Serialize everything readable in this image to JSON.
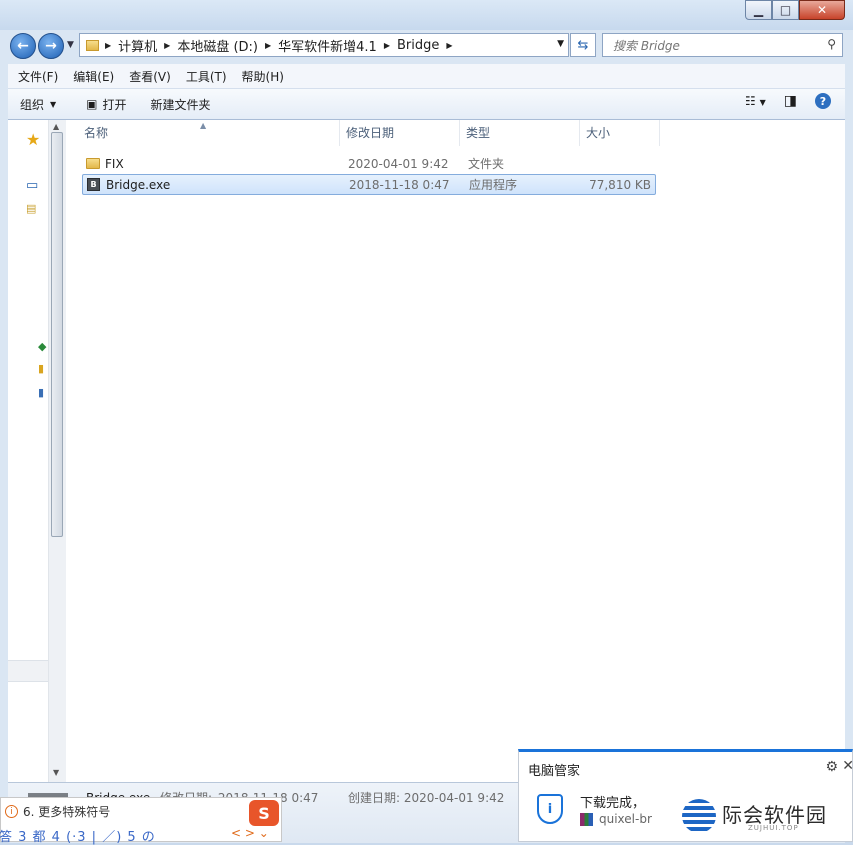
{
  "window": {
    "minimize": "▁",
    "maximize": "□",
    "close": "✕"
  },
  "address": {
    "crumbs": [
      "计算机",
      "本地磁盘 (D:)",
      "华军软件新增4.1",
      "Bridge"
    ],
    "search_placeholder": "搜索 Bridge"
  },
  "menu": [
    "文件(F)",
    "编辑(E)",
    "查看(V)",
    "工具(T)",
    "帮助(H)"
  ],
  "toolbar": {
    "organize": "组织",
    "open": "打开",
    "new_folder": "新建文件夹"
  },
  "columns": [
    "名称",
    "修改日期",
    "类型",
    "大小"
  ],
  "files": [
    {
      "name": "FIX",
      "date": "2020-04-01 9:42",
      "type": "文件夹",
      "size": ""
    },
    {
      "name": "Bridge.exe",
      "date": "2018-11-18 0:47",
      "type": "应用程序",
      "size": "77,810 KB"
    }
  ],
  "details": {
    "name": "Bridge.exe",
    "modified_label": "修改日期:",
    "modified": "2018-11-18 0:47",
    "created_label": "创建日期:",
    "created": "2020-04-01 9:42"
  },
  "ime": {
    "hint": "6. 更多特殊符号",
    "candidates": "答 3 都 4 (·3 | ／) 5 の",
    "pager": "< > ⌄",
    "logo": "S"
  },
  "popup": {
    "title": "电脑管家",
    "message": "下载完成，",
    "file": "quixel-br"
  },
  "watermark": {
    "text": "际会软件园",
    "sub": "ZUJHUI.TOP"
  },
  "colors": {
    "accent": "#1a73d9",
    "selection": "#cfe3fb",
    "folder": "#e3b84a"
  }
}
